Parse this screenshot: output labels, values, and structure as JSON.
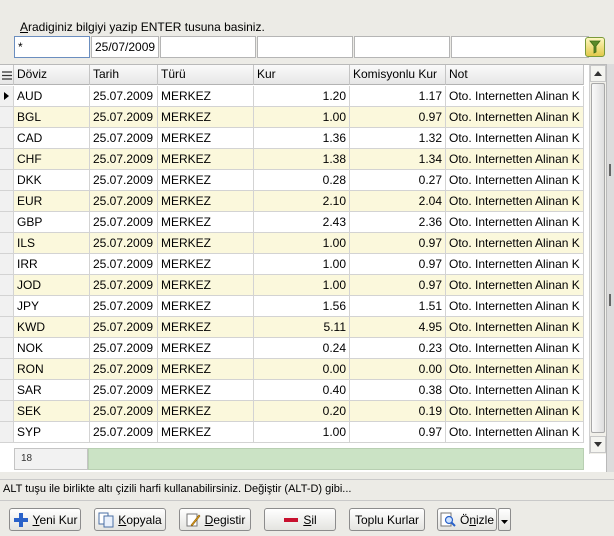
{
  "search": {
    "hint_underlined": "A",
    "hint_rest": "radiginiz bilgiyi yazip ENTER tusuna basiniz.",
    "filters": [
      "*",
      "25/07/2009",
      "",
      "",
      "",
      "",
      ""
    ]
  },
  "grid": {
    "columns": [
      "Döviz",
      "Tarih",
      "Türü",
      "Kur",
      "Komisyonlu Kur",
      "Not"
    ],
    "rows": [
      [
        "AUD",
        "25.07.2009",
        "MERKEZ",
        "1.20",
        "1.17",
        "Oto. Internetten Alinan K"
      ],
      [
        "BGL",
        "25.07.2009",
        "MERKEZ",
        "1.00",
        "0.97",
        "Oto. Internetten Alinan K"
      ],
      [
        "CAD",
        "25.07.2009",
        "MERKEZ",
        "1.36",
        "1.32",
        "Oto. Internetten Alinan K"
      ],
      [
        "CHF",
        "25.07.2009",
        "MERKEZ",
        "1.38",
        "1.34",
        "Oto. Internetten Alinan K"
      ],
      [
        "DKK",
        "25.07.2009",
        "MERKEZ",
        "0.28",
        "0.27",
        "Oto. Internetten Alinan K"
      ],
      [
        "EUR",
        "25.07.2009",
        "MERKEZ",
        "2.10",
        "2.04",
        "Oto. Internetten Alinan K"
      ],
      [
        "GBP",
        "25.07.2009",
        "MERKEZ",
        "2.43",
        "2.36",
        "Oto. Internetten Alinan K"
      ],
      [
        "ILS",
        "25.07.2009",
        "MERKEZ",
        "1.00",
        "0.97",
        "Oto. Internetten Alinan K"
      ],
      [
        "IRR",
        "25.07.2009",
        "MERKEZ",
        "1.00",
        "0.97",
        "Oto. Internetten Alinan K"
      ],
      [
        "JOD",
        "25.07.2009",
        "MERKEZ",
        "1.00",
        "0.97",
        "Oto. Internetten Alinan K"
      ],
      [
        "JPY",
        "25.07.2009",
        "MERKEZ",
        "1.56",
        "1.51",
        "Oto. Internetten Alinan K"
      ],
      [
        "KWD",
        "25.07.2009",
        "MERKEZ",
        "5.11",
        "4.95",
        "Oto. Internetten Alinan K"
      ],
      [
        "NOK",
        "25.07.2009",
        "MERKEZ",
        "0.24",
        "0.23",
        "Oto. Internetten Alinan K"
      ],
      [
        "RON",
        "25.07.2009",
        "MERKEZ",
        "0.00",
        "0.00",
        "Oto. Internetten Alinan K"
      ],
      [
        "SAR",
        "25.07.2009",
        "MERKEZ",
        "0.40",
        "0.38",
        "Oto. Internetten Alinan K"
      ],
      [
        "SEK",
        "25.07.2009",
        "MERKEZ",
        "0.20",
        "0.19",
        "Oto. Internetten Alinan K"
      ],
      [
        "SYP",
        "25.07.2009",
        "MERKEZ",
        "1.00",
        "0.97",
        "Oto. Internetten Alinan K"
      ]
    ],
    "record_count": "18",
    "stripe_color": "#fbf8dc",
    "footer_color": "#cbe3c5"
  },
  "status": {
    "message": "ALT tuşu ile birlikte altı çizili harfi kullanabilirsiniz. Değiştir (ALT-D) gibi..."
  },
  "toolbar": {
    "new_pre": "",
    "new_u": "Y",
    "new_post": "eni Kur",
    "copy_pre": "",
    "copy_u": "K",
    "copy_post": "opyala",
    "edit_pre": "",
    "edit_u": "D",
    "edit_post": "egistir",
    "delete_pre": "",
    "delete_u": "S",
    "delete_post": "il",
    "bulk_label": "Toplu Kurlar",
    "preview_pre": "Ö",
    "preview_u": "n",
    "preview_post": "izle"
  }
}
